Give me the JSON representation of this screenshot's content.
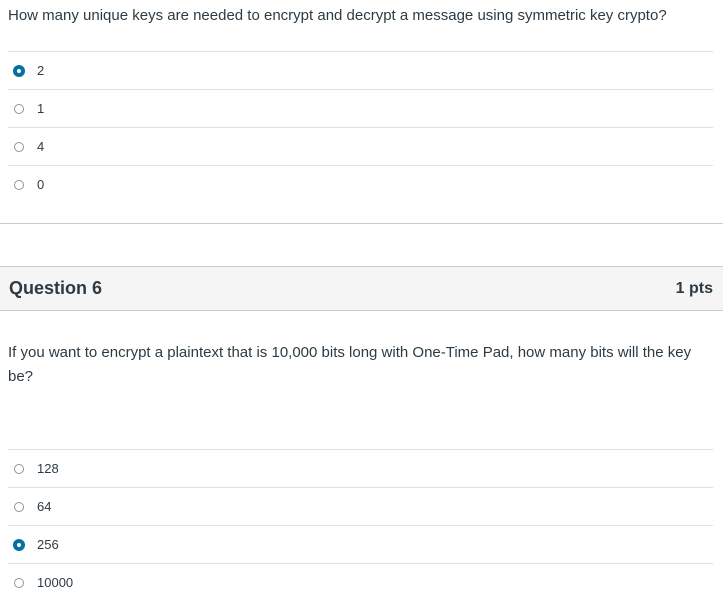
{
  "question5": {
    "text": "How many unique keys are needed to encrypt and decrypt a message using symmetric key crypto?",
    "answers": [
      {
        "label": "2",
        "selected": true
      },
      {
        "label": "1",
        "selected": false
      },
      {
        "label": "4",
        "selected": false
      },
      {
        "label": "0",
        "selected": false
      }
    ]
  },
  "question6": {
    "title": "Question 6",
    "points": "1 pts",
    "text": "If you want to encrypt a plaintext that is 10,000 bits long with One-Time Pad, how many bits will the key be?",
    "answers": [
      {
        "label": "128",
        "selected": false
      },
      {
        "label": "64",
        "selected": false
      },
      {
        "label": "256",
        "selected": true
      },
      {
        "label": "10000",
        "selected": false
      }
    ]
  },
  "colors": {
    "accent": "#0770a3",
    "text": "#2d3b45",
    "header_bg": "#f5f5f5",
    "divider": "#dcdfe3"
  }
}
